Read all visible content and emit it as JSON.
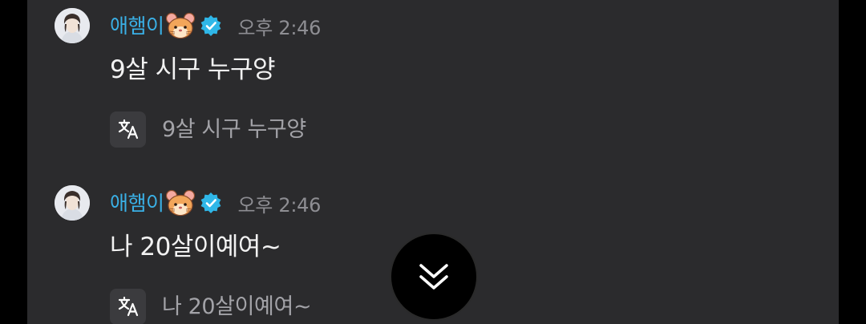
{
  "messages": [
    {
      "author": "애햄이",
      "author_emoji": "hamster-face-icon",
      "verified": true,
      "time": "오후 2:46",
      "text": "9살 시구 누구양",
      "translation": "9살 시구 누구양"
    },
    {
      "author": "애햄이",
      "author_emoji": "hamster-face-icon",
      "verified": true,
      "time": "오후 2:46",
      "text": "나 20살이예여~",
      "translation": "나 20살이예여~"
    }
  ],
  "scroll_button": {
    "icon": "double-chevron-down-icon"
  },
  "colors": {
    "background": "#2b2b2d",
    "author_name": "#3ab0e6",
    "verified_badge": "#2fb7e8",
    "timestamp": "#8e8e93",
    "message_text": "#f2f2f2",
    "translation_text": "#a3a3a8"
  }
}
